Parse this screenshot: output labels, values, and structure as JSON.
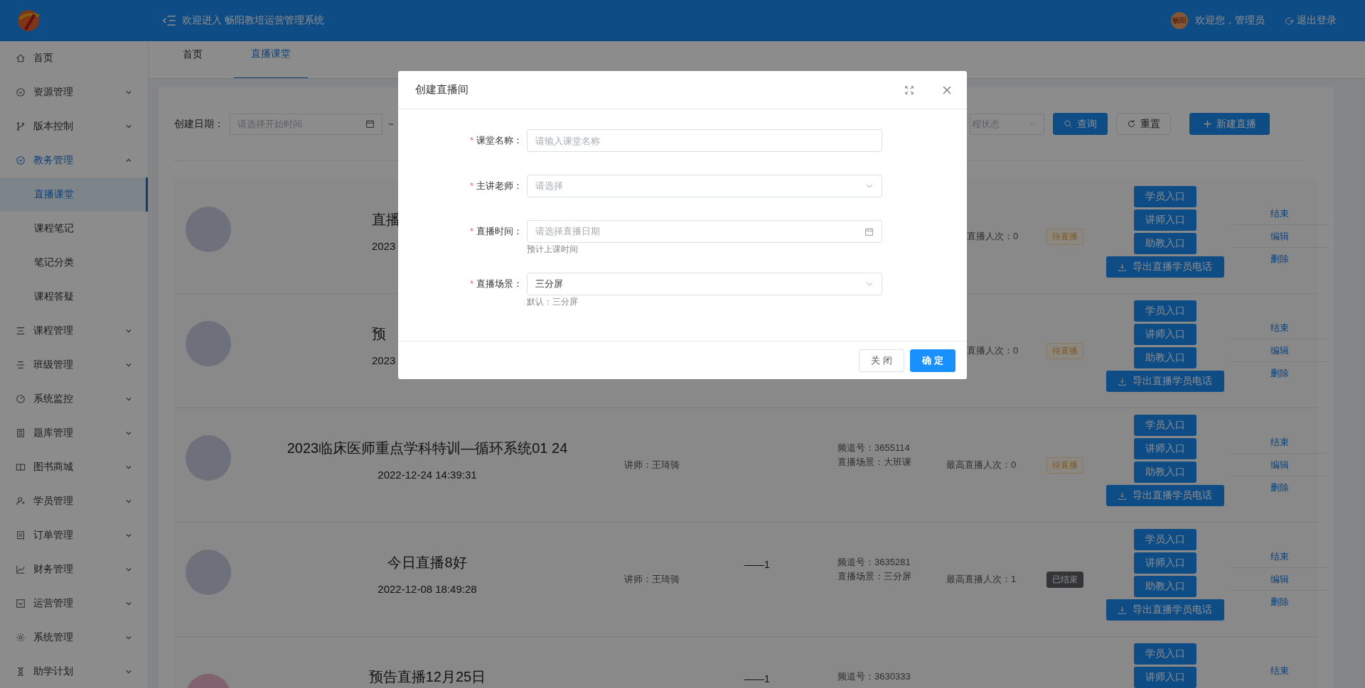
{
  "header": {
    "title": "欢迎进入 畅阳教培运营管理系统",
    "avatar_text": "畅阳",
    "greeting": "欢迎您，管理员",
    "logout": "退出登录"
  },
  "sidebar": {
    "items": [
      {
        "label": "首页",
        "kind": "link",
        "selected": false
      },
      {
        "label": "资源管理",
        "kind": "group",
        "expanded": false
      },
      {
        "label": "版本控制",
        "kind": "group",
        "expanded": false
      },
      {
        "label": "教务管理",
        "kind": "group",
        "expanded": true,
        "children": [
          {
            "label": "直播课堂",
            "selected": true
          },
          {
            "label": "课程笔记",
            "selected": false
          },
          {
            "label": "笔记分类",
            "selected": false
          },
          {
            "label": "课程答疑",
            "selected": false
          }
        ]
      },
      {
        "label": "课程管理",
        "kind": "group",
        "expanded": false
      },
      {
        "label": "班级管理",
        "kind": "group",
        "expanded": false
      },
      {
        "label": "系统监控",
        "kind": "group",
        "expanded": false
      },
      {
        "label": "题库管理",
        "kind": "group",
        "expanded": false
      },
      {
        "label": "图书商城",
        "kind": "group",
        "expanded": false
      },
      {
        "label": "学员管理",
        "kind": "group",
        "expanded": false
      },
      {
        "label": "订单管理",
        "kind": "group",
        "expanded": false
      },
      {
        "label": "财务管理",
        "kind": "group",
        "expanded": false
      },
      {
        "label": "运营管理",
        "kind": "group",
        "expanded": false
      },
      {
        "label": "系统管理",
        "kind": "group",
        "expanded": false
      },
      {
        "label": "助学计划",
        "kind": "group",
        "expanded": false
      }
    ]
  },
  "tabs": [
    {
      "label": "首页",
      "selected": false
    },
    {
      "label": "直播课堂",
      "selected": true
    }
  ],
  "filters": {
    "date_label": "创建日期：",
    "start_placeholder": "请选择开始时间",
    "separator": "~",
    "status_placeholder": "程状态",
    "buttons": [
      {
        "label": "查询",
        "kind": "search"
      },
      {
        "label": "重置",
        "kind": "reset"
      },
      {
        "label": "新建直播",
        "kind": "create"
      }
    ]
  },
  "rows": [
    {
      "avatar": {
        "kind": "photo"
      },
      "cut_by_dialog": true,
      "title": "直播",
      "date": "2023",
      "max_viewers": "直播人次：0",
      "status": {
        "kind": "pending",
        "label": "待直播"
      },
      "buttons": [
        {
          "label": "学员入口",
          "kind": "entry"
        },
        {
          "label": "讲师入口",
          "kind": "entry"
        },
        {
          "label": "助教入口",
          "kind": "entry"
        },
        {
          "label": "导出直播学员电话",
          "kind": "export"
        }
      ],
      "actions": [
        "结束",
        "编辑",
        "删除"
      ]
    },
    {
      "avatar": {
        "kind": "photo"
      },
      "cut_by_dialog": true,
      "title": "预",
      "date": "2023",
      "max_viewers": "直播人次：0",
      "status": {
        "kind": "pending",
        "label": "待直播"
      },
      "buttons": [
        {
          "label": "学员入口",
          "kind": "entry"
        },
        {
          "label": "讲师入口",
          "kind": "entry"
        },
        {
          "label": "助教入口",
          "kind": "entry"
        },
        {
          "label": "导出直播学员电话",
          "kind": "export"
        }
      ],
      "actions": [
        "结束",
        "编辑",
        "删除"
      ]
    },
    {
      "avatar": {
        "kind": "photo"
      },
      "cut_by_dialog": false,
      "title": "2023临床医师重点学科特训—循环系统01 24",
      "date": "2022-12-24 14:39:31",
      "teacher": "讲师：王琦骑",
      "channel": "频道号：3655114",
      "scene": "直播场景：大班课",
      "max_viewers": "最高直播人次：0",
      "status": {
        "kind": "pending",
        "label": "待直播"
      },
      "buttons": [
        {
          "label": "学员入口",
          "kind": "entry"
        },
        {
          "label": "讲师入口",
          "kind": "entry"
        },
        {
          "label": "助教入口",
          "kind": "entry"
        },
        {
          "label": "导出直播学员电话",
          "kind": "export"
        }
      ],
      "actions": [
        "结束",
        "编辑",
        "删除"
      ]
    },
    {
      "avatar": {
        "kind": "photo"
      },
      "cut_by_dialog": false,
      "title": "今日直播8好",
      "date": "2022-12-08 18:49:28",
      "teacher": "讲师：王琦骑",
      "extra": "——1",
      "channel": "频道号：3635281",
      "scene": "直播场景：三分屏",
      "max_viewers": "最高直播人次：1",
      "status": {
        "kind": "ended",
        "label": "已结束"
      },
      "buttons": [
        {
          "label": "学员入口",
          "kind": "entry"
        },
        {
          "label": "讲师入口",
          "kind": "entry"
        },
        {
          "label": "助教入口",
          "kind": "entry"
        },
        {
          "label": "导出直播学员电话",
          "kind": "export"
        }
      ],
      "actions": [
        "结束",
        "编辑",
        "删除"
      ]
    },
    {
      "avatar": {
        "kind": "cartoon"
      },
      "cut_by_dialog": false,
      "title": "预告直播12月25日",
      "extra": "——1",
      "channel": "频道号：3630333",
      "buttons": [
        {
          "label": "学员入口",
          "kind": "entry"
        },
        {
          "label": "讲师入口",
          "kind": "entry"
        }
      ],
      "actions": [
        "结束"
      ]
    }
  ],
  "dialog": {
    "title": "创建直播间",
    "fields": [
      {
        "label": "课堂名称：",
        "required_mark": "*",
        "kind": "input",
        "placeholder": "请输入课堂名称"
      },
      {
        "label": "主讲老师：",
        "required_mark": "*",
        "kind": "select",
        "placeholder": "请选择"
      },
      {
        "label": "直播时间：",
        "required_mark": "*",
        "kind": "date",
        "placeholder": "请选择直播日期",
        "hint": "预计上课时间"
      },
      {
        "label": "直播场景：",
        "required_mark": "*",
        "kind": "select",
        "value": "三分屏",
        "hint": "默认：三分屏"
      }
    ],
    "buttons": [
      {
        "label": "关 闭",
        "kind": "cancel"
      },
      {
        "label": "确 定",
        "kind": "primary"
      }
    ]
  }
}
